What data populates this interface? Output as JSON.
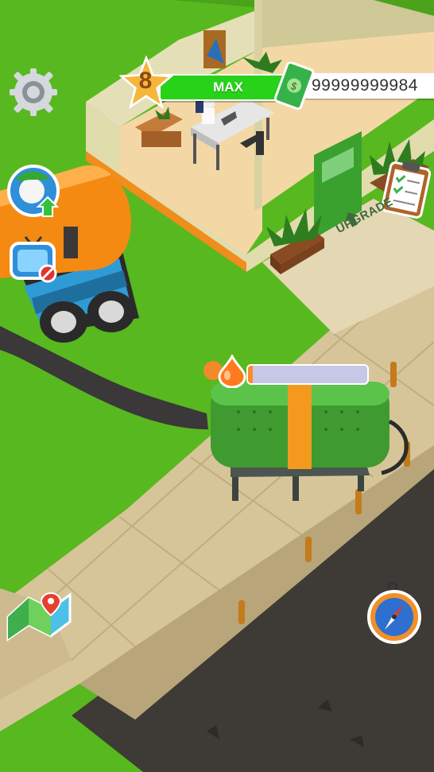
{
  "hud": {
    "level": "8",
    "level_label": "MAX",
    "cash": "99999999984",
    "level_progress": 1.0
  },
  "world": {
    "upgrade_label": "UPGRADE"
  },
  "tank": {
    "fill_fraction": 0.04
  },
  "buttons": {
    "settings": "gear-icon",
    "worker_upgrade": "worker-upgrade-icon",
    "ad_tv": "tv-ad-icon",
    "tasks": "clipboard-icon",
    "map": "map-icon",
    "compass": "compass-icon"
  },
  "colors": {
    "grass": "#58b81f",
    "level_bar": "#27d219",
    "star": "#f6b63a",
    "tank_body": "#3f9b2f",
    "tank_band": "#f39a1e",
    "truck_tank": "#f58a12",
    "truck_cab": "#2f9bd6",
    "fill_bar_track": "#c7c8e6",
    "fill_bar_fill": "#ff8a2a"
  }
}
